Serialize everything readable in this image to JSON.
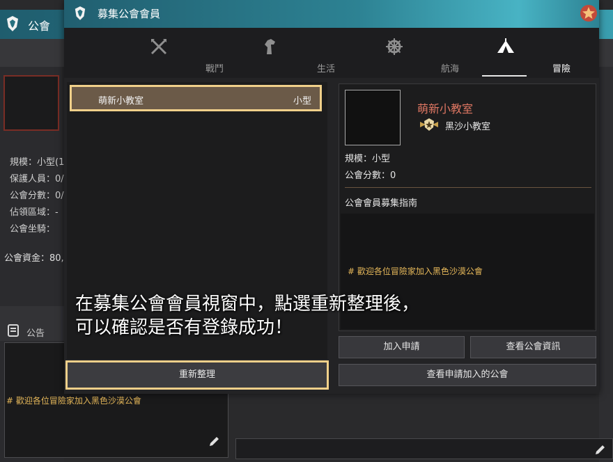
{
  "background_window": {
    "title": "公會",
    "info_lines": [
      "規模：小型(1",
      "保護人員：0/",
      "公會分數：0/",
      "佔領區域：-",
      "公會坐騎："
    ],
    "funds": "公會資金：80,",
    "notice_label": "公告",
    "notice_text": "# 歡迎各位冒險家加入黑色沙漠公會"
  },
  "modal": {
    "title": "募集公會會員",
    "tabs": [
      {
        "label": "戰鬥",
        "icon": "crossed-swords-icon",
        "active": false
      },
      {
        "label": "生活",
        "icon": "horse-head-icon",
        "active": false
      },
      {
        "label": "航海",
        "icon": "ship-wheel-icon",
        "active": false
      },
      {
        "label": "冒險",
        "icon": "tent-icon",
        "active": true
      }
    ],
    "guild_list": [
      {
        "name": "萌新小教室",
        "size": "小型"
      }
    ],
    "refresh_button": "重新整理",
    "detail": {
      "guild_name": "萌新小教室",
      "master": "黑沙小教室",
      "scale": "規模：小型",
      "score": "公會分數：0",
      "guide_label": "公會會員募集指南",
      "guide_text": "# 歡迎各位冒險家加入黑色沙漠公會"
    },
    "buttons": {
      "apply": "加入申請",
      "view_info": "查看公會資訊",
      "view_applied": "查看申請加入的公會"
    }
  },
  "overlay": {
    "line1": "在募集公會會員視窗中，點選重新整理後，",
    "line2": "可以確認是否有登錄成功！"
  },
  "colors": {
    "accent_border": "#f0d08a",
    "guild_name_red": "#e07763",
    "notice_gold": "#e6b85a",
    "title_teal": "#2d8293"
  }
}
